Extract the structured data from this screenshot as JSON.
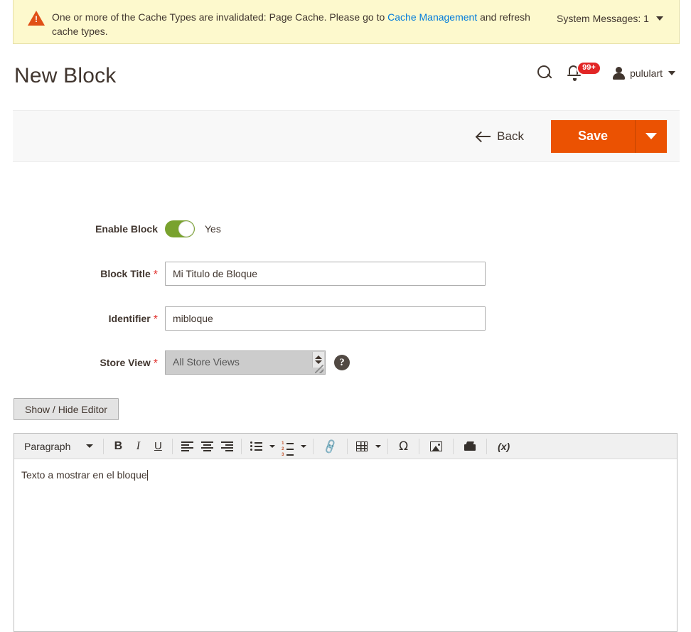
{
  "banner": {
    "icon": "warning-triangle-icon",
    "text_before_link": "One or more of the Cache Types are invalidated: Page Cache. Please go to ",
    "link_label": "Cache Management",
    "text_after_link": " and refresh cache types.",
    "system_messages_label": "System Messages: 1",
    "bg_color": "#fdf9cd",
    "icon_color": "#e04f16",
    "link_color": "#007bdb"
  },
  "header": {
    "page_title": "New Block",
    "search_icon": "search-icon",
    "notifications": {
      "icon": "bell-icon",
      "badge_count": "99+",
      "badge_color": "#e22626"
    },
    "user": {
      "avatar_icon": "user-avatar-icon",
      "name": "pululart",
      "caret": "chevron-down-icon"
    }
  },
  "action_bar": {
    "back_label": "Back",
    "back_icon": "arrow-left-icon",
    "save_label": "Save",
    "save_caret_icon": "chevron-down-icon",
    "save_color": "#eb5202"
  },
  "form": {
    "enable_block": {
      "label": "Enable Block",
      "toggle_state": "on",
      "toggle_value_label": "Yes",
      "toggle_on_color": "#79a22e"
    },
    "block_title": {
      "label": "Block Title",
      "required_marker": "*",
      "value": "Mi Titulo de Bloque",
      "placeholder": ""
    },
    "identifier": {
      "label": "Identifier",
      "required_marker": "*",
      "value": "mibloque",
      "placeholder": ""
    },
    "store_view": {
      "label": "Store View",
      "required_marker": "*",
      "selected_option": "All Store Views",
      "options": [
        "All Store Views"
      ],
      "help_icon": "question-mark-icon"
    }
  },
  "editor": {
    "show_hide_button_label": "Show / Hide Editor",
    "toolbar": {
      "block_format_label": "Paragraph",
      "buttons": [
        {
          "name": "bold-button",
          "label": "B"
        },
        {
          "name": "italic-button",
          "label": "I"
        },
        {
          "name": "underline-button",
          "label": "U"
        },
        {
          "name": "align-left-button",
          "label": ""
        },
        {
          "name": "align-center-button",
          "label": ""
        },
        {
          "name": "align-right-button",
          "label": ""
        },
        {
          "name": "bullet-list-button",
          "label": ""
        },
        {
          "name": "numbered-list-button",
          "label": ""
        },
        {
          "name": "insert-link-button",
          "label": ""
        },
        {
          "name": "insert-table-button",
          "label": ""
        },
        {
          "name": "special-character-button",
          "label": "Ω"
        },
        {
          "name": "insert-image-button",
          "label": ""
        },
        {
          "name": "insert-widget-button",
          "label": ""
        },
        {
          "name": "insert-variable-button",
          "label": "(x)"
        }
      ]
    },
    "content": "Texto a mostrar en el bloque"
  }
}
